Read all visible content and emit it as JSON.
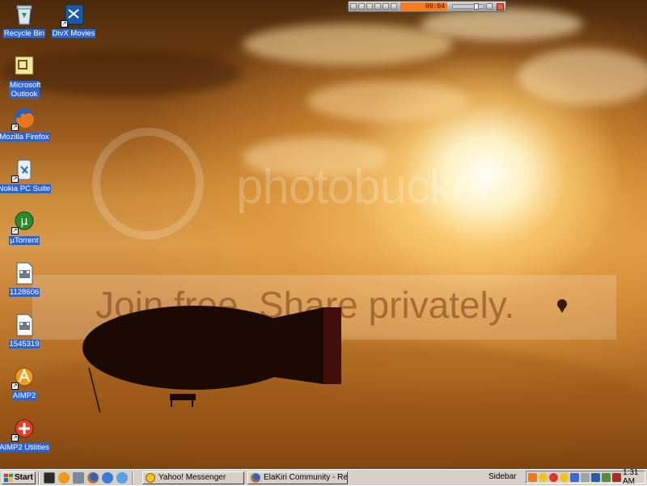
{
  "desktop": {
    "icons": [
      {
        "label": "Recycle Bin",
        "icon": "recycle-bin-icon"
      },
      {
        "label": "DivX Movies",
        "icon": "divx-icon"
      },
      {
        "label": "Microsoft Outlook",
        "icon": "outlook-icon"
      },
      {
        "label": "Mozilla Firefox",
        "icon": "firefox-icon"
      },
      {
        "label": "Nokia PC Suite",
        "icon": "nokia-pc-suite-icon"
      },
      {
        "label": "µTorrent",
        "icon": "utorrent-icon"
      },
      {
        "label": "1128606",
        "icon": "media-file-icon"
      },
      {
        "label": "1545319",
        "icon": "media-file-icon"
      },
      {
        "label": "AIMP2",
        "icon": "aimp-icon"
      },
      {
        "label": "AIMP2 Utilities",
        "icon": "aimp-utilities-icon"
      }
    ],
    "watermark": {
      "brand": "photobucket",
      "slogan": "Join free. Share privately."
    }
  },
  "player": {
    "time": "00:04"
  },
  "taskbar": {
    "start_label": "Start",
    "quick_launch": [
      "show-desktop-icon",
      "aimp-icon",
      "calculator-icon",
      "firefox-icon",
      "ie-icon",
      "browser-icon"
    ],
    "tasks": [
      {
        "label": "Yahoo! Messenger",
        "icon": "yahoo-messenger-icon"
      },
      {
        "label": "ElaKiri Community - Repl...",
        "icon": "firefox-icon"
      }
    ],
    "sidebar_label": "Sidebar",
    "tray_icons": [
      "play-icon",
      "smiley-icon",
      "messenger-icon",
      "smiley-icon",
      "network-icon",
      "speaker-icon",
      "nokia-icon",
      "hardware-icon",
      "shield-icon"
    ],
    "clock": "1:31 AM"
  },
  "colors": {
    "taskbar": "#d4d0c8",
    "icon_label_highlight": "#3163c5",
    "player_display": "#ff7a1a"
  }
}
